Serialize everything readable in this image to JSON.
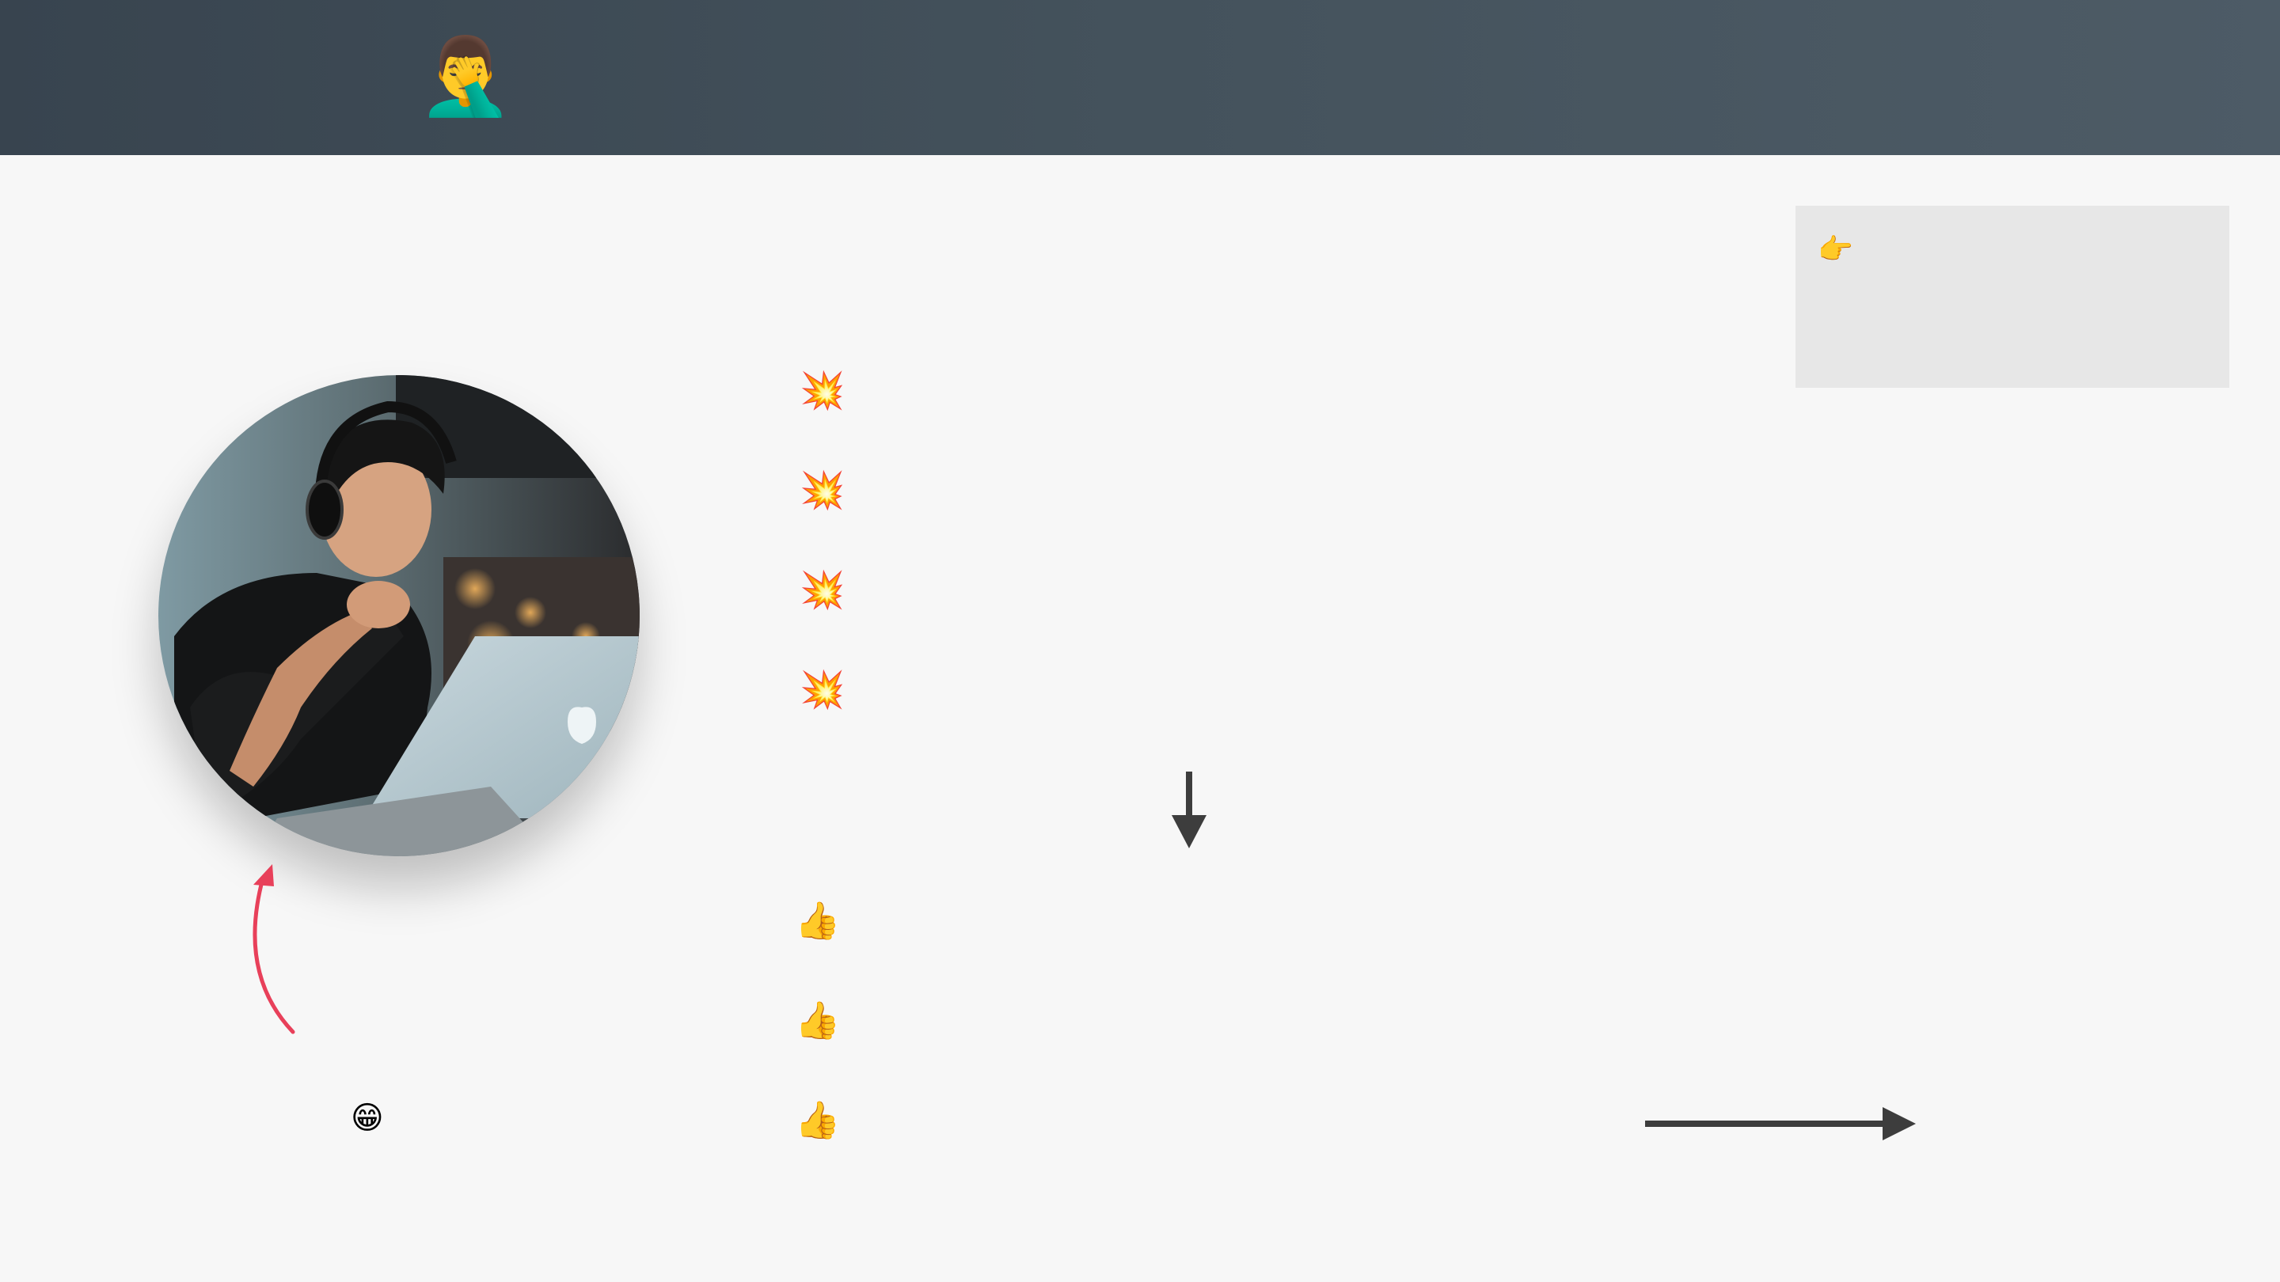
{
  "header": {
    "icon": "face-palm-emoji",
    "emoji": "🤦‍♂️"
  },
  "note": {
    "icon": "pointing-right-emoji",
    "emoji": "👉"
  },
  "problems": {
    "icon": "collision-emoji",
    "items": [
      "💥",
      "💥",
      "💥",
      "💥"
    ]
  },
  "benefits": {
    "icon": "thumbs-up-emoji",
    "items": [
      "👍",
      "👍",
      "👍"
    ]
  },
  "caption": {
    "icon": "grinning-face-emoji",
    "emoji": "😁"
  },
  "colors": {
    "header_start": "#38444f",
    "header_end": "#4d5b66",
    "background": "#f7f7f7",
    "note_box": "#e7e7e7",
    "curved_arrow": "#e8405a",
    "straight_arrows": "#3d3d3d"
  }
}
